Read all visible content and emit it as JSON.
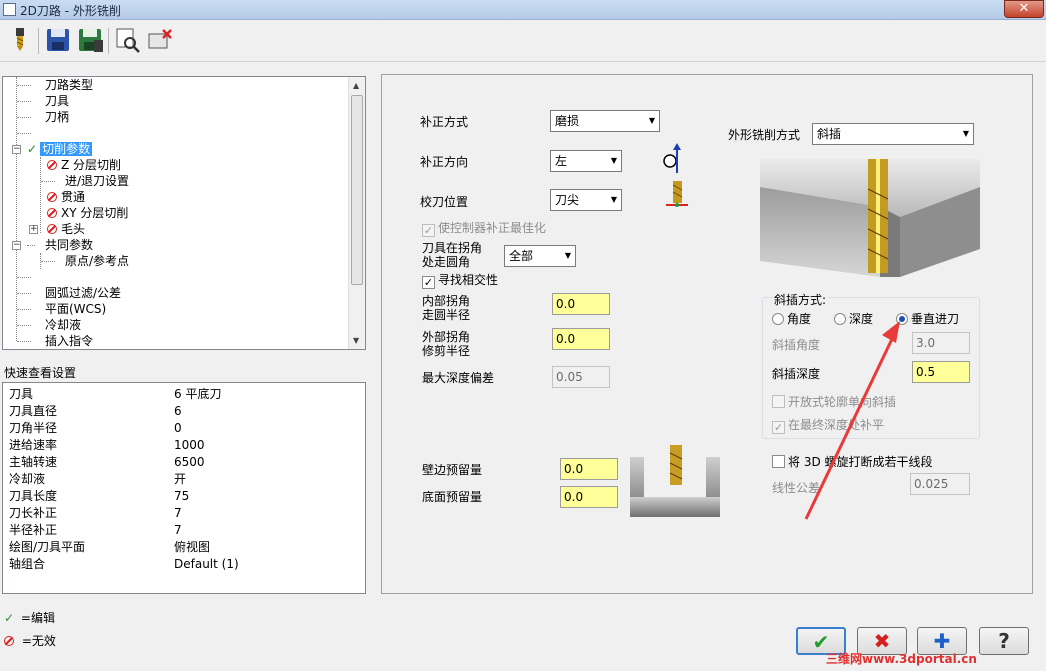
{
  "window": {
    "title": "2D刀路 - 外形铣削",
    "close_glyph": "✕"
  },
  "toolbar": [
    "tool-icon",
    "save-icon",
    "save-as-icon",
    "preview-icon",
    "delete-icon"
  ],
  "tree": {
    "items": [
      {
        "label": "刀路类型"
      },
      {
        "label": "刀具"
      },
      {
        "label": "刀柄"
      },
      {
        "label": ""
      },
      {
        "label": "切削参数"
      },
      {
        "label": "Z 分层切削"
      },
      {
        "label": "进/退刀设置"
      },
      {
        "label": "贯通"
      },
      {
        "label": "XY 分层切削"
      },
      {
        "label": "毛头"
      },
      {
        "label": "共同参数"
      },
      {
        "label": "原点/参考点"
      },
      {
        "label": ""
      },
      {
        "label": "圆弧过滤/公差"
      },
      {
        "label": "平面(WCS)"
      },
      {
        "label": "冷却液"
      },
      {
        "label": "插入指令"
      }
    ]
  },
  "quick_view": {
    "title": "快速查看设置",
    "rows": [
      {
        "key": "刀具",
        "value": "6 平底刀"
      },
      {
        "key": "刀具直径",
        "value": "6"
      },
      {
        "key": "刀角半径",
        "value": "0"
      },
      {
        "key": "进给速率",
        "value": "1000"
      },
      {
        "key": "主轴转速",
        "value": "6500"
      },
      {
        "key": "冷却液",
        "value": "开"
      },
      {
        "key": "刀具长度",
        "value": "75"
      },
      {
        "key": "刀长补正",
        "value": "7"
      },
      {
        "key": "半径补正",
        "value": "7"
      },
      {
        "key": "绘图/刀具平面",
        "value": "俯视图"
      },
      {
        "key": "轴组合",
        "value": "Default (1)"
      }
    ]
  },
  "legend": {
    "edit": "=编辑",
    "invalid": "=无效"
  },
  "params": {
    "comp_type_label": "补正方式",
    "comp_type_value": "磨损",
    "comp_dir_label": "补正方向",
    "comp_dir_value": "左",
    "tip_comp_label": "校刀位置",
    "tip_comp_value": "刀尖",
    "optimize_label": "使控制器补正最佳化",
    "roll_corners_label_1": "刀具在拐角",
    "roll_corners_label_2": "处走圆角",
    "roll_corners_value": "全部",
    "intersect_label": "寻找相交性",
    "inner_corner_label_1": "内部拐角",
    "inner_corner_label_2": "走圆半径",
    "inner_corner_value": "0.0",
    "outer_corner_label_1": "外部拐角",
    "outer_corner_label_2": "修剪半径",
    "outer_corner_value": "0.0",
    "max_depth_label": "最大深度偏差",
    "max_depth_value": "0.05",
    "wall_stock_label": "壁边预留量",
    "wall_stock_value": "0.0",
    "floor_stock_label": "底面预留量",
    "floor_stock_value": "0.0",
    "contour_type_label": "外形铣削方式",
    "contour_type_value": "斜插"
  },
  "ramp": {
    "group_label": "斜插方式:",
    "angle_label": "角度",
    "depth_label": "深度",
    "plunge_label": "垂直进刀",
    "ramp_angle_label": "斜插角度",
    "ramp_angle_value": "3.0",
    "ramp_depth_label": "斜插深度",
    "ramp_depth_value": "0.5",
    "open_contour_label": "开放式轮廓单向斜插",
    "final_depth_label": "在最终深度处补平"
  },
  "helix": {
    "break_label": "将 3D 螺旋打断成若干线段",
    "linear_tol_label": "线性公差",
    "linear_tol_value": "0.025"
  },
  "buttons": {
    "ok": "✔",
    "cancel": "✖",
    "add": "✚",
    "help": "?"
  },
  "watermark": "三维网www.3dportal.cn",
  "colors": {
    "highlight_field": "#ffff99",
    "selected": "#3399ff",
    "arrow": "#e83a3a"
  }
}
